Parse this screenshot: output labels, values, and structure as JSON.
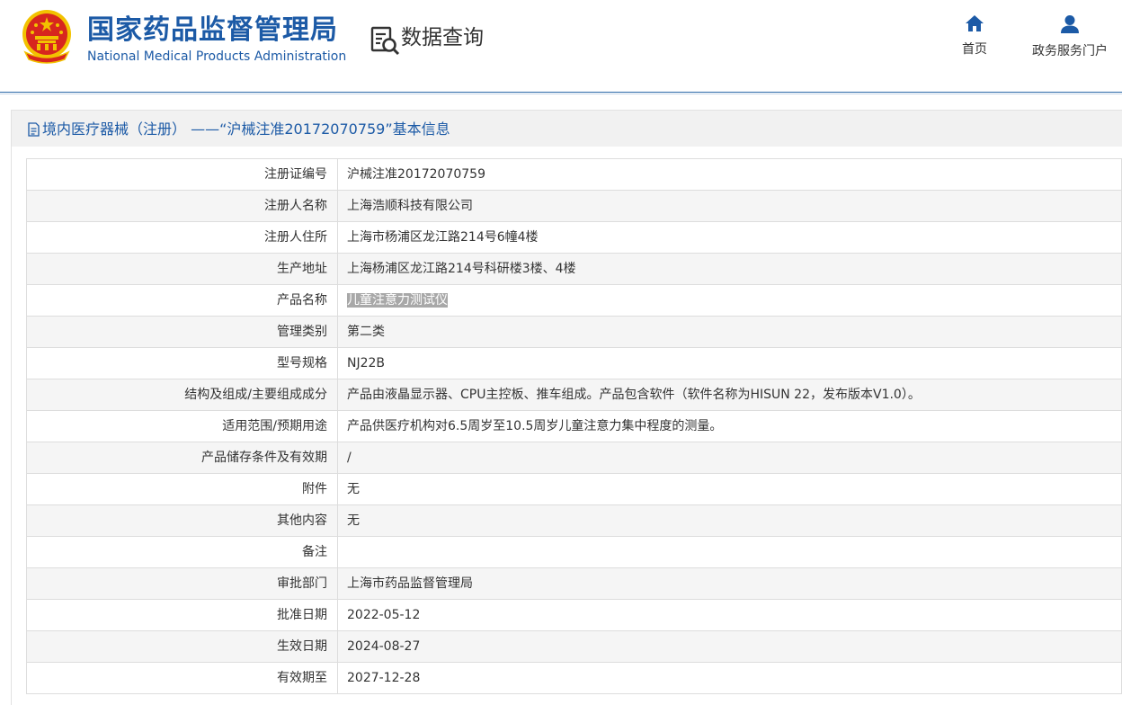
{
  "header": {
    "org_name_cn": "国家药品监督管理局",
    "org_name_en": "National Medical Products Administration",
    "section_title": "数据查询",
    "nav": [
      {
        "label": "首页",
        "icon": "home-icon"
      },
      {
        "label": "政务服务门户",
        "icon": "user-icon"
      }
    ]
  },
  "panel": {
    "title": "境内医疗器械（注册） ——“沪械注准20172070759”基本信息"
  },
  "rows": [
    {
      "label": "注册证编号",
      "value": "沪械注准20172070759"
    },
    {
      "label": "注册人名称",
      "value": "上海浩顺科技有限公司"
    },
    {
      "label": "注册人住所",
      "value": "上海市杨浦区龙江路214号6幢4楼"
    },
    {
      "label": "生产地址",
      "value": "上海杨浦区龙江路214号科研楼3楼、4楼"
    },
    {
      "label": "产品名称",
      "value": "儿童注意力测试仪"
    },
    {
      "label": "管理类别",
      "value": "第二类"
    },
    {
      "label": "型号规格",
      "value": "NJ22B"
    },
    {
      "label": "结构及组成/主要组成成分",
      "value": "产品由液晶显示器、CPU主控板、推车组成。产品包含软件（软件名称为HISUN 22，发布版本V1.0）。"
    },
    {
      "label": "适用范围/预期用途",
      "value": "产品供医疗机构对6.5周岁至10.5周岁儿童注意力集中程度的测量。"
    },
    {
      "label": "产品储存条件及有效期",
      "value": "/"
    },
    {
      "label": "附件",
      "value": "无"
    },
    {
      "label": "其他内容",
      "value": "无"
    },
    {
      "label": "备注",
      "value": ""
    },
    {
      "label": "审批部门",
      "value": "上海市药品监督管理局"
    },
    {
      "label": "批准日期",
      "value": "2022-05-12"
    },
    {
      "label": "生效日期",
      "value": "2024-08-27"
    },
    {
      "label": "有效期至",
      "value": "2027-12-28"
    }
  ],
  "colors": {
    "brand_blue": "#1c5aa6",
    "emblem_red": "#d7261e",
    "emblem_gold": "#f2c200",
    "text_selection": "#a8a8a8"
  }
}
